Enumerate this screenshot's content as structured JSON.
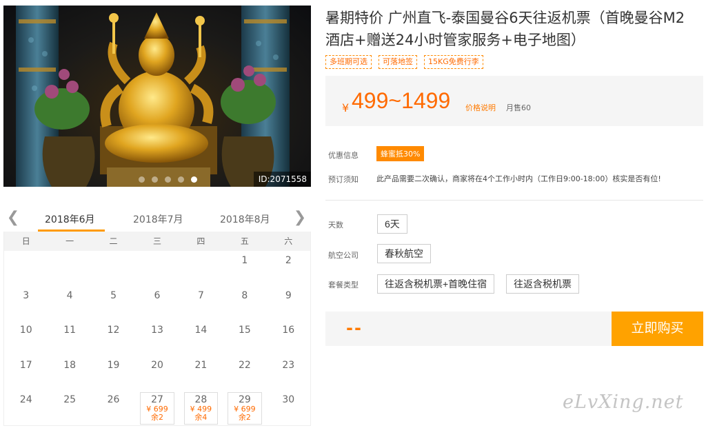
{
  "hero": {
    "image_id": "ID:2071558",
    "slide_count": 5,
    "active_slide": 5
  },
  "calendar": {
    "months": [
      "2018年6月",
      "2018年7月",
      "2018年8月"
    ],
    "selected_month": "2018年6月",
    "weekdays": [
      "日",
      "一",
      "二",
      "三",
      "四",
      "五",
      "六"
    ],
    "days": [
      {
        "day": ""
      },
      {
        "day": ""
      },
      {
        "day": ""
      },
      {
        "day": ""
      },
      {
        "day": ""
      },
      {
        "day": "1"
      },
      {
        "day": "2"
      },
      {
        "day": "3"
      },
      {
        "day": "4"
      },
      {
        "day": "5"
      },
      {
        "day": "6"
      },
      {
        "day": "7"
      },
      {
        "day": "8"
      },
      {
        "day": "9"
      },
      {
        "day": "10"
      },
      {
        "day": "11"
      },
      {
        "day": "12"
      },
      {
        "day": "13"
      },
      {
        "day": "14"
      },
      {
        "day": "15"
      },
      {
        "day": "16"
      },
      {
        "day": "17"
      },
      {
        "day": "18"
      },
      {
        "day": "19"
      },
      {
        "day": "20"
      },
      {
        "day": "21"
      },
      {
        "day": "22"
      },
      {
        "day": "23"
      },
      {
        "day": "24"
      },
      {
        "day": "25"
      },
      {
        "day": "26"
      },
      {
        "day": "27",
        "price": "¥ 699",
        "stock": "余2"
      },
      {
        "day": "28",
        "price": "¥ 499",
        "stock": "余4"
      },
      {
        "day": "29",
        "price": "¥ 699",
        "stock": "余2"
      },
      {
        "day": "30"
      }
    ]
  },
  "product": {
    "title": "暑期特价 广州直飞-泰国曼谷6天往返机票（首晚曼谷M2酒店+赠送24小时管家服务+电子地图）",
    "tags": [
      "多班期可选",
      "可落地签",
      "15KG免费行李"
    ]
  },
  "price": {
    "currency": "¥",
    "range": "499~1499",
    "explain_label": "价格说明",
    "sold_label": "月售60"
  },
  "promo": {
    "label": "优惠信息",
    "badge": "蜂蜜抵30%"
  },
  "notice": {
    "label": "预订须知",
    "text": "此产品需要二次确认，商家将在4个工作小时内（工作日9:00-18:00）核实是否有位!"
  },
  "options": {
    "days_label": "天数",
    "days_value": "6天",
    "airline_label": "航空公司",
    "airline_value": "春秋航空",
    "package_label": "套餐类型",
    "package_values": [
      "往返含税机票+首晚住宿",
      "往返含税机票"
    ]
  },
  "purchase": {
    "selected_price": "--",
    "buy_label": "立即购买"
  },
  "watermark": "eLvXing.net",
  "colors": {
    "accent": "#ff6a00",
    "buy_button": "#ffa200",
    "calendar_underline": "#ff9a00"
  }
}
